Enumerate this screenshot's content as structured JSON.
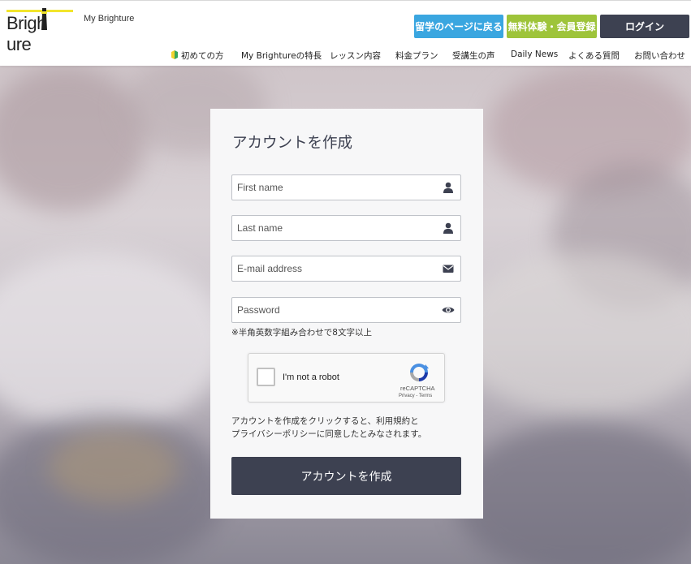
{
  "header": {
    "logo_text": "Brigh ure",
    "sub_brand": "My Brighture",
    "buttons": {
      "study": "留学のページに戻る",
      "trial": "無料体験・会員登録",
      "login": "ログイン"
    },
    "nav": [
      "初めての方",
      "My Brightureの特長",
      "レッスン内容",
      "料金プラン",
      "受講生の声",
      "Daily News",
      "よくある質問",
      "お問い合わせ"
    ]
  },
  "form": {
    "title": "アカウントを作成",
    "fields": {
      "first_name": "First name",
      "last_name": "Last name",
      "email": "E-mail address",
      "password": "Password"
    },
    "password_hint": "※半角英数字組み合わせで8文字以上",
    "captcha": {
      "label": "I'm not a robot",
      "brand": "reCAPTCHA",
      "links": "Privacy - Terms"
    },
    "terms_line1": "アカウントを作成をクリックすると、利用規約と",
    "terms_line2": "プライバシーポリシーに同意したとみなされます。",
    "submit": "アカウントを作成"
  },
  "colors": {
    "study": "#3aa6e0",
    "trial": "#9ec43a",
    "login": "#3d4151",
    "submit": "#3d4151",
    "logo_accent": "#f2e52c"
  }
}
